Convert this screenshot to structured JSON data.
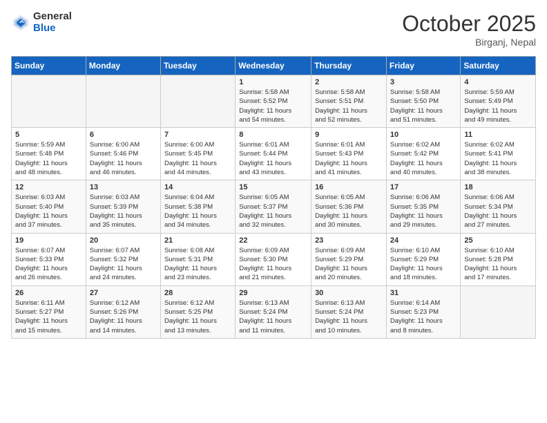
{
  "header": {
    "logo_general": "General",
    "logo_blue": "Blue",
    "month_title": "October 2025",
    "location": "Birganj, Nepal"
  },
  "weekdays": [
    "Sunday",
    "Monday",
    "Tuesday",
    "Wednesday",
    "Thursday",
    "Friday",
    "Saturday"
  ],
  "weeks": [
    [
      {
        "day": "",
        "info": ""
      },
      {
        "day": "",
        "info": ""
      },
      {
        "day": "",
        "info": ""
      },
      {
        "day": "1",
        "info": "Sunrise: 5:58 AM\nSunset: 5:52 PM\nDaylight: 11 hours\nand 54 minutes."
      },
      {
        "day": "2",
        "info": "Sunrise: 5:58 AM\nSunset: 5:51 PM\nDaylight: 11 hours\nand 52 minutes."
      },
      {
        "day": "3",
        "info": "Sunrise: 5:58 AM\nSunset: 5:50 PM\nDaylight: 11 hours\nand 51 minutes."
      },
      {
        "day": "4",
        "info": "Sunrise: 5:59 AM\nSunset: 5:49 PM\nDaylight: 11 hours\nand 49 minutes."
      }
    ],
    [
      {
        "day": "5",
        "info": "Sunrise: 5:59 AM\nSunset: 5:48 PM\nDaylight: 11 hours\nand 48 minutes."
      },
      {
        "day": "6",
        "info": "Sunrise: 6:00 AM\nSunset: 5:46 PM\nDaylight: 11 hours\nand 46 minutes."
      },
      {
        "day": "7",
        "info": "Sunrise: 6:00 AM\nSunset: 5:45 PM\nDaylight: 11 hours\nand 44 minutes."
      },
      {
        "day": "8",
        "info": "Sunrise: 6:01 AM\nSunset: 5:44 PM\nDaylight: 11 hours\nand 43 minutes."
      },
      {
        "day": "9",
        "info": "Sunrise: 6:01 AM\nSunset: 5:43 PM\nDaylight: 11 hours\nand 41 minutes."
      },
      {
        "day": "10",
        "info": "Sunrise: 6:02 AM\nSunset: 5:42 PM\nDaylight: 11 hours\nand 40 minutes."
      },
      {
        "day": "11",
        "info": "Sunrise: 6:02 AM\nSunset: 5:41 PM\nDaylight: 11 hours\nand 38 minutes."
      }
    ],
    [
      {
        "day": "12",
        "info": "Sunrise: 6:03 AM\nSunset: 5:40 PM\nDaylight: 11 hours\nand 37 minutes."
      },
      {
        "day": "13",
        "info": "Sunrise: 6:03 AM\nSunset: 5:39 PM\nDaylight: 11 hours\nand 35 minutes."
      },
      {
        "day": "14",
        "info": "Sunrise: 6:04 AM\nSunset: 5:38 PM\nDaylight: 11 hours\nand 34 minutes."
      },
      {
        "day": "15",
        "info": "Sunrise: 6:05 AM\nSunset: 5:37 PM\nDaylight: 11 hours\nand 32 minutes."
      },
      {
        "day": "16",
        "info": "Sunrise: 6:05 AM\nSunset: 5:36 PM\nDaylight: 11 hours\nand 30 minutes."
      },
      {
        "day": "17",
        "info": "Sunrise: 6:06 AM\nSunset: 5:35 PM\nDaylight: 11 hours\nand 29 minutes."
      },
      {
        "day": "18",
        "info": "Sunrise: 6:06 AM\nSunset: 5:34 PM\nDaylight: 11 hours\nand 27 minutes."
      }
    ],
    [
      {
        "day": "19",
        "info": "Sunrise: 6:07 AM\nSunset: 5:33 PM\nDaylight: 11 hours\nand 26 minutes."
      },
      {
        "day": "20",
        "info": "Sunrise: 6:07 AM\nSunset: 5:32 PM\nDaylight: 11 hours\nand 24 minutes."
      },
      {
        "day": "21",
        "info": "Sunrise: 6:08 AM\nSunset: 5:31 PM\nDaylight: 11 hours\nand 23 minutes."
      },
      {
        "day": "22",
        "info": "Sunrise: 6:09 AM\nSunset: 5:30 PM\nDaylight: 11 hours\nand 21 minutes."
      },
      {
        "day": "23",
        "info": "Sunrise: 6:09 AM\nSunset: 5:29 PM\nDaylight: 11 hours\nand 20 minutes."
      },
      {
        "day": "24",
        "info": "Sunrise: 6:10 AM\nSunset: 5:29 PM\nDaylight: 11 hours\nand 18 minutes."
      },
      {
        "day": "25",
        "info": "Sunrise: 6:10 AM\nSunset: 5:28 PM\nDaylight: 11 hours\nand 17 minutes."
      }
    ],
    [
      {
        "day": "26",
        "info": "Sunrise: 6:11 AM\nSunset: 5:27 PM\nDaylight: 11 hours\nand 15 minutes."
      },
      {
        "day": "27",
        "info": "Sunrise: 6:12 AM\nSunset: 5:26 PM\nDaylight: 11 hours\nand 14 minutes."
      },
      {
        "day": "28",
        "info": "Sunrise: 6:12 AM\nSunset: 5:25 PM\nDaylight: 11 hours\nand 13 minutes."
      },
      {
        "day": "29",
        "info": "Sunrise: 6:13 AM\nSunset: 5:24 PM\nDaylight: 11 hours\nand 11 minutes."
      },
      {
        "day": "30",
        "info": "Sunrise: 6:13 AM\nSunset: 5:24 PM\nDaylight: 11 hours\nand 10 minutes."
      },
      {
        "day": "31",
        "info": "Sunrise: 6:14 AM\nSunset: 5:23 PM\nDaylight: 11 hours\nand 8 minutes."
      },
      {
        "day": "",
        "info": ""
      }
    ]
  ]
}
